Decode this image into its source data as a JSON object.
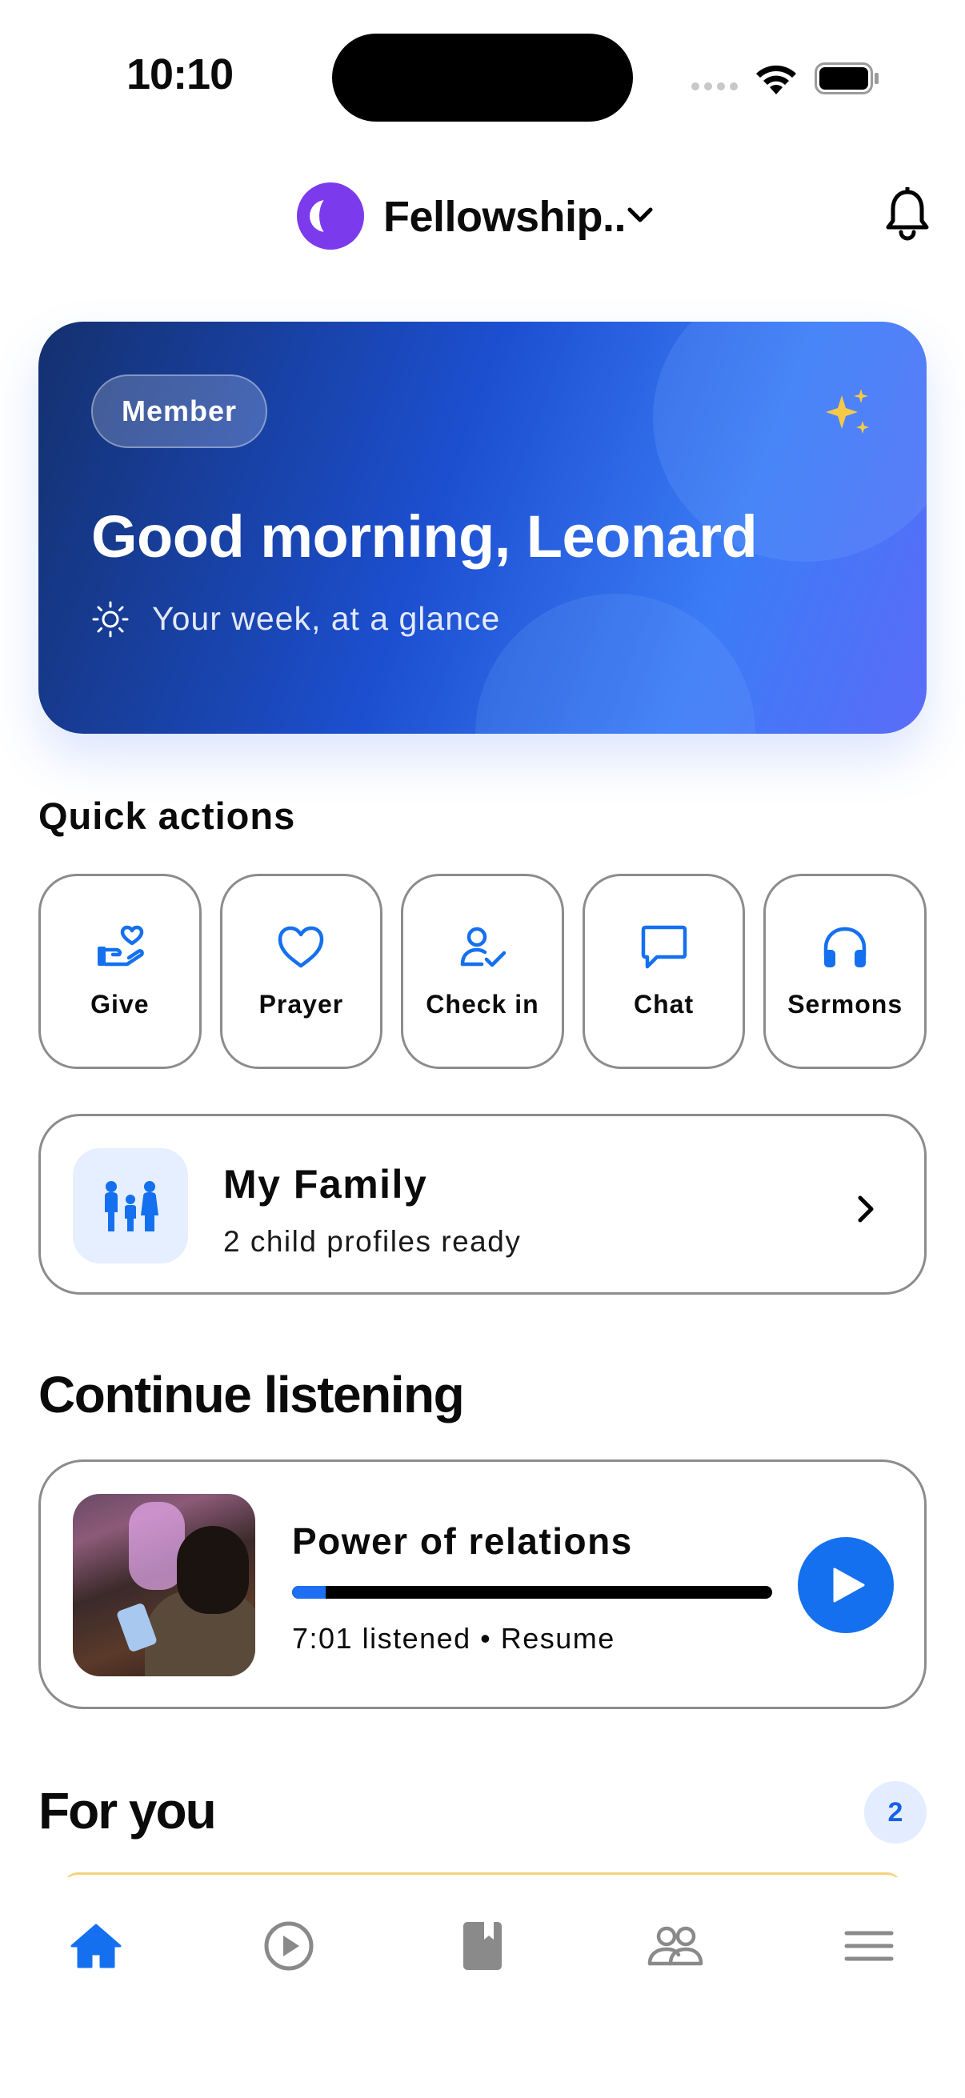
{
  "status_bar": {
    "time": "10:10"
  },
  "header": {
    "org_name": "Fellowship.."
  },
  "hero": {
    "badge": "Member",
    "greeting": "Good morning, Leonard",
    "subtitle": "Your week, at a glance"
  },
  "quick_actions": {
    "title": "Quick actions",
    "items": [
      {
        "label": "Give",
        "icon": "give-heart-hand-icon"
      },
      {
        "label": "Prayer",
        "icon": "heart-icon"
      },
      {
        "label": "Check in",
        "icon": "user-check-icon"
      },
      {
        "label": "Chat",
        "icon": "chat-bubble-icon"
      },
      {
        "label": "Sermons",
        "icon": "headphones-icon"
      }
    ]
  },
  "family": {
    "title": "My Family",
    "subtitle": "2 child profiles ready"
  },
  "continue_listening": {
    "title": "Continue listening",
    "track_title": "Power of relations",
    "meta": "7:01 listened • Resume",
    "progress": 0.07
  },
  "for_you": {
    "title": "For you",
    "count": "2"
  },
  "tabbar": {
    "items": [
      {
        "name": "home-icon",
        "active": true
      },
      {
        "name": "play-circle-icon",
        "active": false
      },
      {
        "name": "bible-book-icon",
        "active": false
      },
      {
        "name": "people-icon",
        "active": false
      },
      {
        "name": "menu-icon",
        "active": false
      }
    ]
  },
  "colors": {
    "accent": "#1570ef",
    "brand_purple": "#7c3aed",
    "inactive": "#8a8a8a"
  }
}
